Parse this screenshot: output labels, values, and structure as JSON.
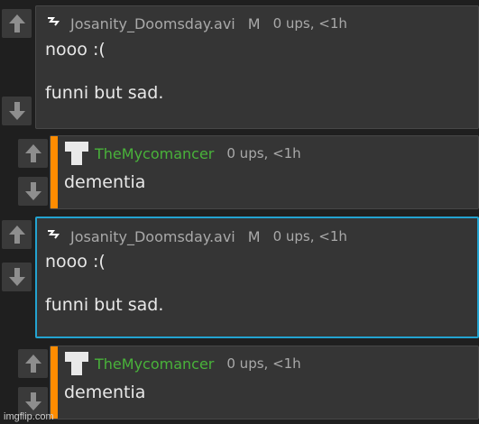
{
  "comments": [
    {
      "username": "Josanity_Doomsday.avi",
      "badge": "M",
      "ups": "0 ups, <1h",
      "line1": "nooo :(",
      "line2": "funni but sad.",
      "avatar": "flag-icon",
      "is_reply": false,
      "selected": false
    },
    {
      "username": "TheMycomancer",
      "ups": "0 ups, <1h",
      "line1": "dementia",
      "avatar": "shirt-icon",
      "is_reply": true
    },
    {
      "username": "Josanity_Doomsday.avi",
      "badge": "M",
      "ups": "0 ups, <1h",
      "line1": "nooo :(",
      "line2": "funni but sad.",
      "avatar": "flag-icon",
      "is_reply": false,
      "selected": true
    },
    {
      "username": "TheMycomancer",
      "ups": "0 ups, <1h",
      "line1": "dementia",
      "avatar": "shirt-icon",
      "is_reply": true
    }
  ],
  "colors": {
    "background": "#1f1f1f",
    "card": "#353535",
    "reply_bar": "#ff8c00",
    "selected_border": "#23a3d0",
    "username_green": "#49b33a"
  },
  "watermark": "imgflip.com"
}
